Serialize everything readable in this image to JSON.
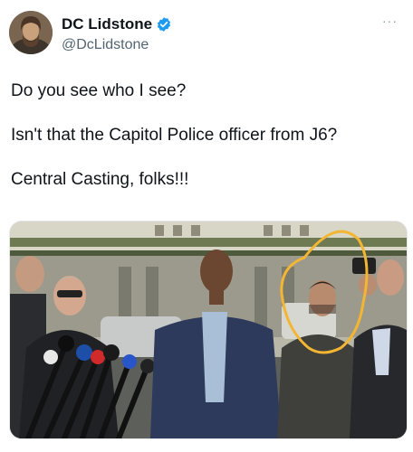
{
  "author": {
    "display_name": "DC Lidstone",
    "handle": "@DcLidstone",
    "avatar_icon": "portrait-avatar",
    "verified_icon": "verified-badge-icon"
  },
  "tweet": {
    "lines": [
      "Do you see who I see?",
      "Isn't that the Capitol Police officer from J6?",
      "Central Casting, folks!!!"
    ]
  },
  "media": {
    "description_icon": "press-conference-photo",
    "highlight_color": "#f2b632"
  },
  "colors": {
    "verified": "#1d9bf0",
    "secondary_text": "#536471"
  }
}
